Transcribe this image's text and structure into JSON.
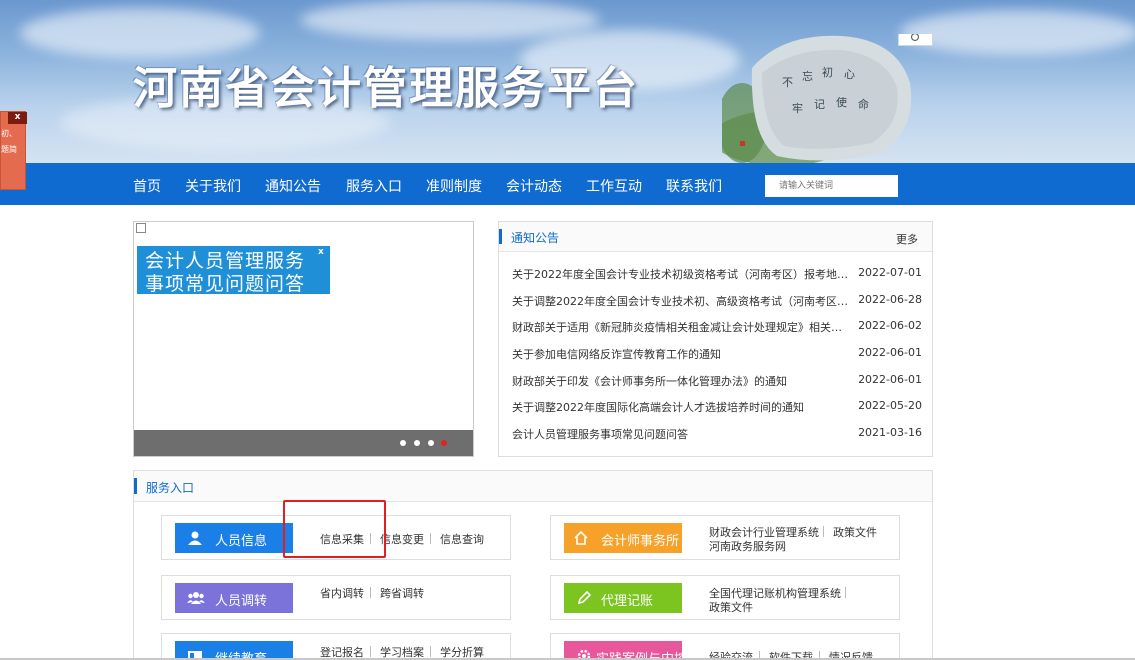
{
  "banner": {
    "title": "河南省会计管理服务平台",
    "rock_inscription": [
      "不",
      "忘",
      "初",
      "心",
      "牢",
      "记",
      "使",
      "命"
    ]
  },
  "nav": {
    "items": [
      "首页",
      "关于我们",
      "通知公告",
      "服务入口",
      "准则制度",
      "会计动态",
      "工作互动",
      "联系我们"
    ],
    "search_placeholder": "请输入关键词"
  },
  "float_ad": {
    "close_label": "x",
    "lines": [
      "初、",
      "题简"
    ]
  },
  "slider": {
    "slide_lines": [
      "会计人员管理服务",
      "事项常见问题问答"
    ],
    "close_label": "x",
    "dots_count": 4,
    "active_dot": 4
  },
  "notice": {
    "title": "通知公告",
    "more_label": "更多",
    "items": [
      {
        "text": "关于2022年度全国会计专业技术初级资格考试（河南考区）报考地点...",
        "date": "2022-07-01"
      },
      {
        "text": "关于调整2022年度全国会计专业技术初、高级资格考试（河南考区）...",
        "date": "2022-06-28"
      },
      {
        "text": "财政部关于适用《新冠肺炎疫情相关租金减让会计处理规定》相关问...",
        "date": "2022-06-02"
      },
      {
        "text": "关于参加电信网络反诈宣传教育工作的通知",
        "date": "2022-06-01"
      },
      {
        "text": "财政部关于印发《会计师事务所一体化管理办法》的通知",
        "date": "2022-06-01"
      },
      {
        "text": "关于调整2022年度国际化高端会计人才选拔培养时间的通知",
        "date": "2022-05-20"
      },
      {
        "text": "会计人员管理服务事项常见问题问答",
        "date": "2021-03-16"
      }
    ]
  },
  "service": {
    "title": "服务入口",
    "boxes": [
      {
        "label": "人员信息",
        "icon": "person-icon",
        "color": "#1a7fe6",
        "links": [
          "信息采集",
          "信息变更",
          "信息查询"
        ]
      },
      {
        "label": "会计师事务所",
        "icon": "home-icon",
        "color": "#f5a12a",
        "links": [
          "财政会计行业管理系统",
          "政策文件",
          "河南政务服务网"
        ]
      },
      {
        "label": "人员调转",
        "icon": "group-icon",
        "color": "#7b73d9",
        "links": [
          "省内调转",
          "跨省调转"
        ]
      },
      {
        "label": "代理记账",
        "icon": "pen-icon",
        "color": "#7cc41f",
        "links": [
          "全国代理记账机构管理系统",
          "政策文件"
        ]
      },
      {
        "label": "继续教育",
        "icon": "id-card-icon",
        "color": "#1a7fe6",
        "links": [
          "登记报名",
          "学习档案",
          "学分折算"
        ]
      },
      {
        "label": "实践案例与内控",
        "icon": "gear-icon",
        "color": "#e8569c",
        "links": [
          "经验交流",
          "软件下载",
          "情况反馈"
        ]
      }
    ]
  }
}
